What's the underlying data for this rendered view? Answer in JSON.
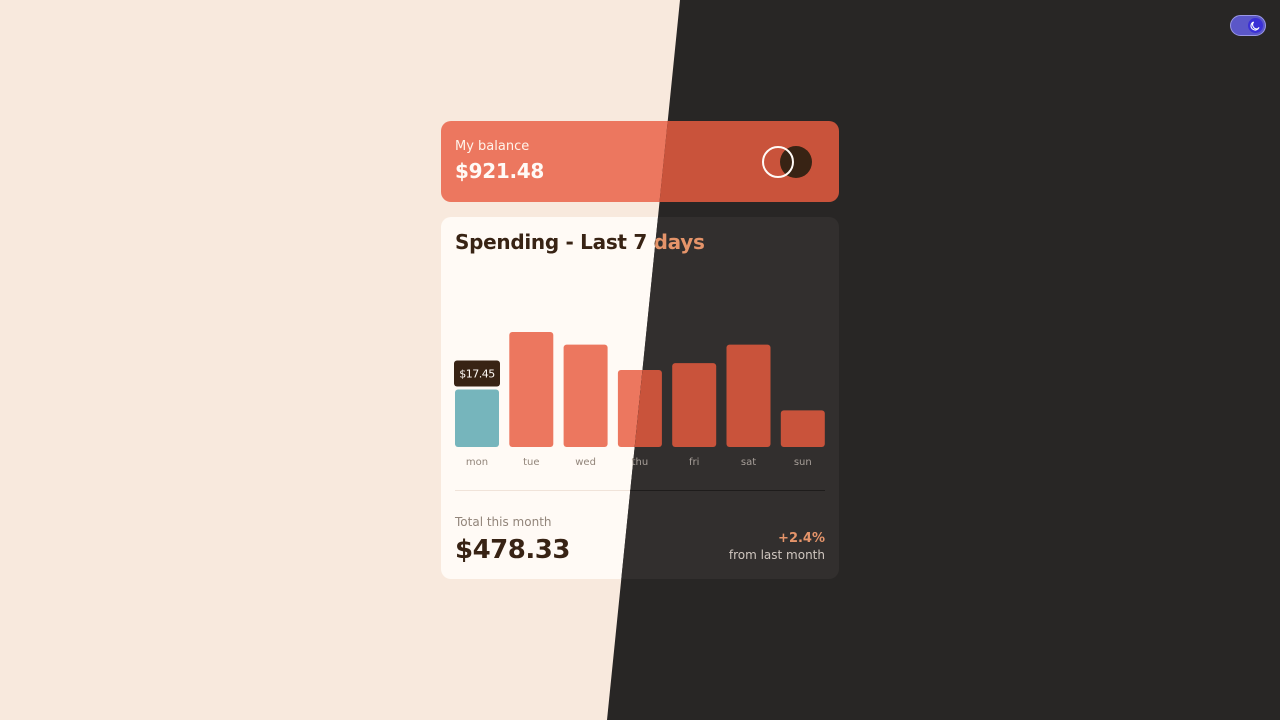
{
  "balance": {
    "label": "My balance",
    "value": "$921.48"
  },
  "spending": {
    "title": "Spending - Last 7 days",
    "total_label": "Total this month",
    "total_value": "$478.33",
    "change_value": "+2.4%",
    "change_label": "from last month"
  },
  "theme_toggle": {
    "icon": "moon-icon",
    "state": "dark"
  },
  "colors": {
    "bar": "#ec775f",
    "bar_active": "#76b5bc",
    "tooltip_bg": "#382314",
    "tooltip_text": "#fffaf6",
    "light_bg": "#f8e9dd",
    "dark_bg": "#282625"
  },
  "chart_data": {
    "type": "bar",
    "categories": [
      "mon",
      "tue",
      "wed",
      "thu",
      "fri",
      "sat",
      "sun"
    ],
    "values": [
      17.45,
      34.91,
      31.07,
      23.39,
      25.48,
      31.07,
      11.12
    ],
    "active_index": 0,
    "tooltip": "$17.45",
    "ylim": [
      0,
      34.91
    ]
  }
}
